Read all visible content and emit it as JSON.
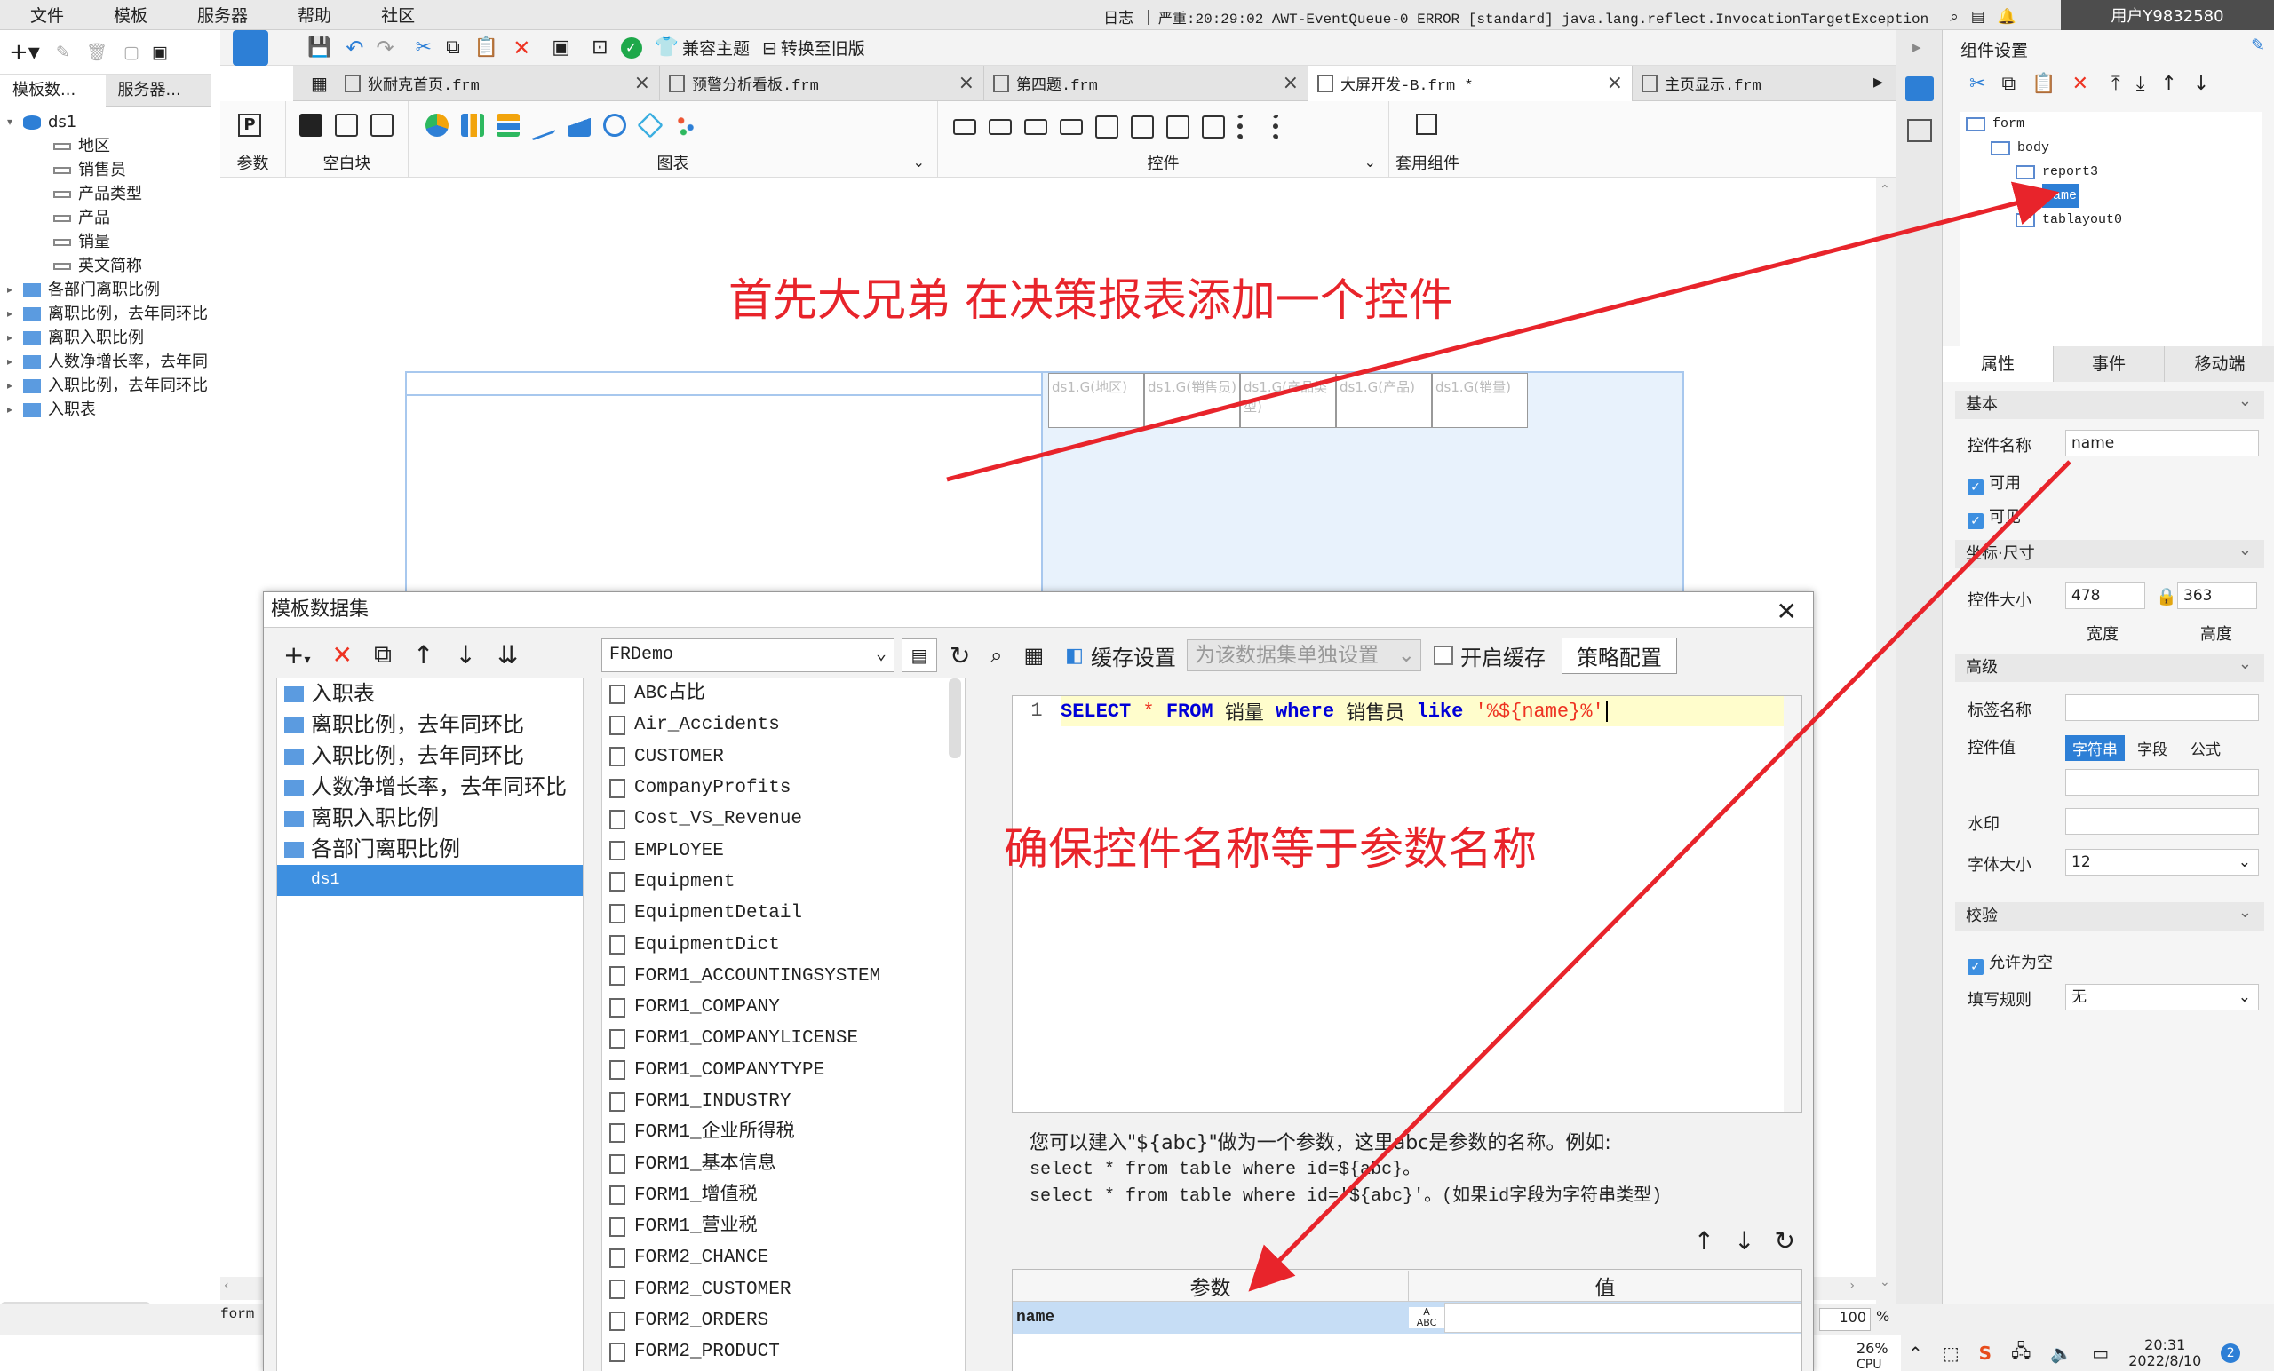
{
  "menubar": {
    "items": [
      "文件",
      "模板",
      "服务器",
      "帮助",
      "社区"
    ],
    "log_label": "日志",
    "log_message": "严重:20:29:02 AWT-EventQueue-0 ERROR [standard] java.lang.reflect.InvocationTargetException",
    "user": "用户Y9832580"
  },
  "left_panel": {
    "tabs": [
      "模板数...",
      "服务器..."
    ],
    "tree": [
      {
        "label": "ds1",
        "level": 0,
        "expanded": true
      },
      {
        "label": "地区",
        "level": 1
      },
      {
        "label": "销售员",
        "level": 1
      },
      {
        "label": "产品类型",
        "level": 1
      },
      {
        "label": "产品",
        "level": 1
      },
      {
        "label": "销量",
        "level": 1
      },
      {
        "label": "英文简称",
        "level": 1
      },
      {
        "label": "各部门离职比例",
        "level": 0
      },
      {
        "label": "离职比例，去年同环比",
        "level": 0
      },
      {
        "label": "离职入职比例",
        "level": 0
      },
      {
        "label": "人数净增长率，去年同",
        "level": 0
      },
      {
        "label": "入职比例，去年同环比",
        "level": 0
      },
      {
        "label": "入职表",
        "level": 0
      }
    ]
  },
  "toolbar": {
    "compat_theme": "兼容主题",
    "switch_old": "转换至旧版"
  },
  "doc_tabs": [
    {
      "label": "狄耐克首页.frm",
      "active": false
    },
    {
      "label": "预警分析看板.frm",
      "active": false
    },
    {
      "label": "第四题.frm",
      "active": false
    },
    {
      "label": "大屏开发-B.frm *",
      "active": true
    },
    {
      "label": "主页显示.frm",
      "active": false
    }
  ],
  "palette_groups": [
    "参数",
    "空白块",
    "图表",
    "控件",
    "套用组件"
  ],
  "report_cells": [
    "ds1.G(地区)",
    "ds1.G(销售员)",
    "ds1.G(产品类型)",
    "ds1.G(产品)",
    "ds1.G(销量)"
  ],
  "annotations": {
    "top": "首先大兄弟 在决策报表添加一个控件",
    "middle": "确保控件名称等于参数名称"
  },
  "dialog": {
    "title": "模板数据集",
    "datasets": [
      "入职表",
      "离职比例，去年同环比",
      "入职比例，去年同环比",
      "人数净增长率，去年同环比",
      "离职入职比例",
      "各部门离职比例",
      "ds1"
    ],
    "selected_dataset": "ds1",
    "connection": "FRDemo",
    "tables": [
      "ABC占比",
      "Air_Accidents",
      "CUSTOMER",
      "CompanyProfits",
      "Cost_VS_Revenue",
      "EMPLOYEE",
      "Equipment",
      "EquipmentDetail",
      "EquipmentDict",
      "FORM1_ACCOUNTINGSYSTEM",
      "FORM1_COMPANY",
      "FORM1_COMPANYLICENSE",
      "FORM1_COMPANYTYPE",
      "FORM1_INDUSTRY",
      "FORM1_企业所得税",
      "FORM1_基本信息",
      "FORM1_增值税",
      "FORM1_营业税",
      "FORM2_CHANCE",
      "FORM2_CUSTOMER",
      "FORM2_ORDERS",
      "FORM2_PRODUCT"
    ],
    "cache_label": "缓存设置",
    "cache_option": "为该数据集单独设置",
    "enable_cache": "开启缓存",
    "strategy": "策略配置",
    "line_no": "1",
    "sql": {
      "kw_select": "SELECT",
      "star": "*",
      "kw_from": "FROM",
      "table": "销量",
      "kw_where": "where",
      "col": "销售员",
      "kw_like": "like",
      "literal": "'%${name}%'"
    },
    "hint_line1": "您可以建入\"${abc}\"做为一个参数，这里abc是参数的名称。例如:",
    "hint_line2": "select * from table where id=${abc}。",
    "hint_line3": "select * from table where id='${abc}'。(如果id字段为字符串类型)",
    "param_header": "参数",
    "value_header": "值",
    "param_name": "name"
  },
  "right_panel": {
    "title": "组件设置",
    "tree": [
      {
        "label": "form",
        "level": 0
      },
      {
        "label": "body",
        "level": 1
      },
      {
        "label": "report3",
        "level": 2
      },
      {
        "label": "name",
        "level": 2,
        "selected": true
      },
      {
        "label": "tablayout0",
        "level": 2
      }
    ],
    "tabs": [
      "属性",
      "事件",
      "移动端"
    ],
    "section_basic": "基本",
    "widget_name_label": "控件名称",
    "widget_name_value": "name",
    "enabled": "可用",
    "visible": "可见",
    "section_size": "坐标·尺寸",
    "size_label": "控件大小",
    "width_value": "478",
    "height_value": "363",
    "width_label": "宽度",
    "height_label": "高度",
    "section_advanced": "高级",
    "tag_label": "标签名称",
    "value_label": "控件值",
    "value_tabs": [
      "字符串",
      "字段",
      "公式"
    ],
    "watermark": "水印",
    "font_size_label": "字体大小",
    "font_size_value": "12",
    "section_validate": "校验",
    "allow_empty": "允许为空",
    "fill_rule_label": "填写规则",
    "fill_rule_value": "无"
  },
  "status": {
    "left": "form",
    "zoom": "100",
    "zoom_unit": "%"
  },
  "taskbar": {
    "cpu": "26%",
    "cpu_label": "CPU",
    "time": "20:31",
    "date": "2022/8/10",
    "badge": "2"
  }
}
